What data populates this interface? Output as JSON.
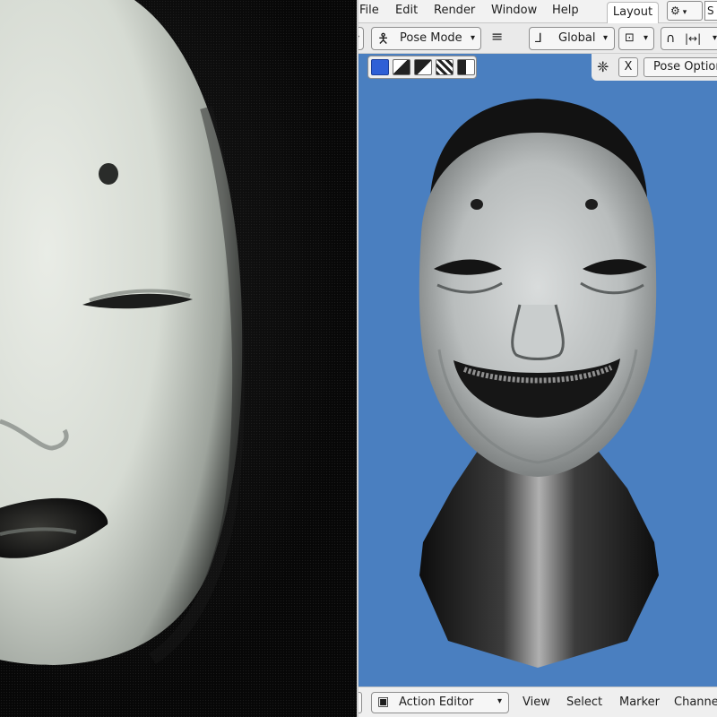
{
  "menubar": {
    "items": [
      "File",
      "Edit",
      "Render",
      "Window",
      "Help"
    ],
    "active_tab": "Layout",
    "scene_field": "S"
  },
  "header": {
    "mode": "Pose Mode",
    "transform_orientation": "Global"
  },
  "toolrow": {
    "x_toggle": "X",
    "pose_options": "Pose Options"
  },
  "footer": {
    "editor_type": "Action Editor",
    "menus": [
      "View",
      "Select",
      "Marker",
      "Channel"
    ]
  },
  "colors": {
    "viewport_bg": "#4a7fc0",
    "ui_light": "#eaeaea",
    "selection_blue": "#2e5fd6"
  }
}
